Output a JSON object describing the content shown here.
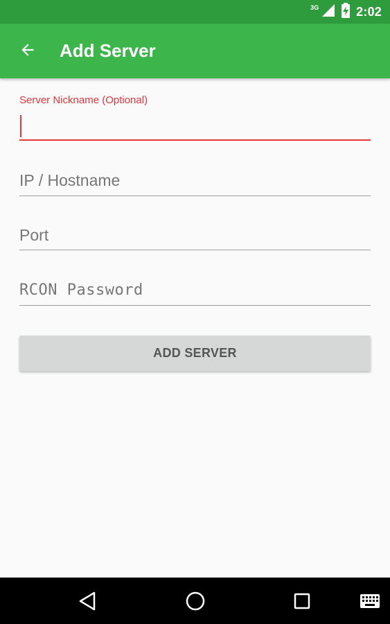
{
  "status_bar": {
    "network_label": "3G",
    "time": "2:02",
    "icons": [
      "signal-icon",
      "battery-icon"
    ]
  },
  "app_bar": {
    "title": "Add Server",
    "back_icon": "arrow-back-icon",
    "color": "#3cb64a"
  },
  "form": {
    "nickname": {
      "label": "Server Nickname (Optional)",
      "value": ""
    },
    "hostname": {
      "placeholder": "IP / Hostname",
      "value": ""
    },
    "port": {
      "placeholder": "Port",
      "value": ""
    },
    "rcon_password": {
      "placeholder": "RCON Password",
      "value": ""
    },
    "submit_label": "ADD SERVER"
  },
  "nav_bar": {
    "icons": [
      "back-triangle-icon",
      "home-circle-icon",
      "recents-square-icon",
      "keyboard-icon"
    ]
  },
  "colors": {
    "accent": "#e53935",
    "primary": "#3cb64a",
    "primary_dark": "#2e9c3c"
  }
}
